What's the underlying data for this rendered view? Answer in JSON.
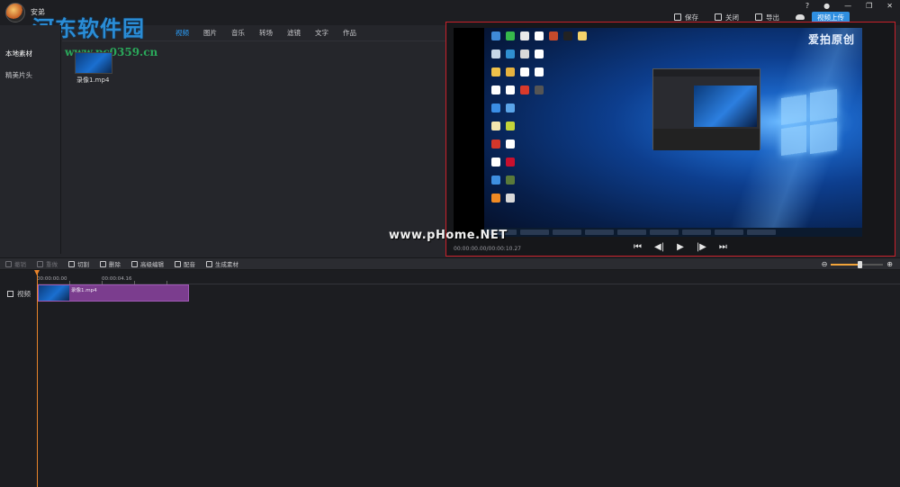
{
  "titlebar": {
    "username": "安弟",
    "save": "保存",
    "close": "关闭",
    "export": "导出",
    "upload": "视频上传",
    "help": "?",
    "win_min": "—",
    "win_max": "❐",
    "win_close": "✕"
  },
  "watermark": {
    "site_name": "河东软件园",
    "url": "www.pc0359.cn",
    "preview_watermark": "www.pHome.NET"
  },
  "sidebar": {
    "items": [
      {
        "label": "本地素材"
      },
      {
        "label": "精美片头"
      }
    ]
  },
  "media_tabs": [
    {
      "label": "视频",
      "active": true
    },
    {
      "label": "图片"
    },
    {
      "label": "音乐"
    },
    {
      "label": "转场"
    },
    {
      "label": "滤镜"
    },
    {
      "label": "文字"
    },
    {
      "label": "作品"
    }
  ],
  "media_items": [
    {
      "name": "录像1.mp4"
    }
  ],
  "preview": {
    "brand": "爱拍原创",
    "time": "00:00:00.00/00:00:10.27"
  },
  "toolbar": {
    "tools": [
      {
        "label": "撤销",
        "disabled": true
      },
      {
        "label": "重做",
        "disabled": true
      },
      {
        "label": "切割"
      },
      {
        "label": "删除"
      },
      {
        "label": "高级编辑"
      },
      {
        "label": "配音"
      },
      {
        "label": "生成素材"
      }
    ],
    "zoom_level": 0.55
  },
  "timeline": {
    "track_label": "视频",
    "ruler_ticks": [
      "00:00:00.00",
      "00:00:04.16"
    ],
    "clip_label": "录像1.mp4"
  },
  "colors": {
    "accent": "#2aa1ff",
    "clip": "#7b3d8e",
    "playhead": "#e8842a",
    "preview_border": "#c8202a"
  }
}
